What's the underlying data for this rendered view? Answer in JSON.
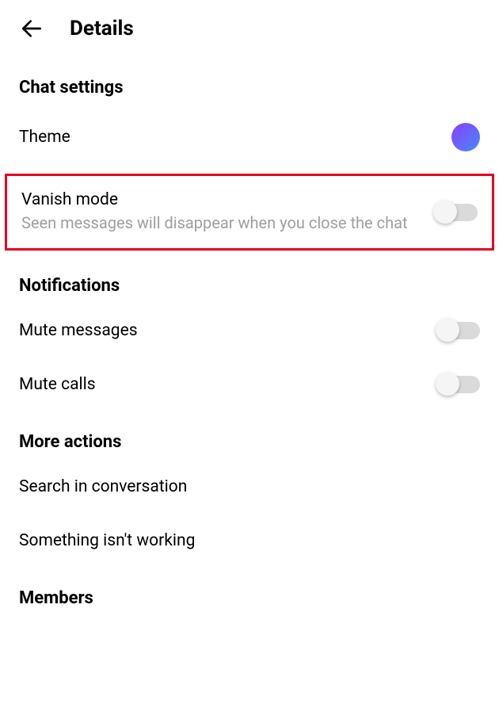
{
  "header": {
    "title": "Details"
  },
  "sections": {
    "chat_settings": {
      "title": "Chat settings",
      "theme": {
        "label": "Theme"
      },
      "vanish_mode": {
        "label": "Vanish mode",
        "description": "Seen messages will disappear when you close the chat",
        "enabled": false
      }
    },
    "notifications": {
      "title": "Notifications",
      "mute_messages": {
        "label": "Mute messages",
        "enabled": false
      },
      "mute_calls": {
        "label": "Mute calls",
        "enabled": false
      }
    },
    "more_actions": {
      "title": "More actions",
      "search": {
        "label": "Search in conversation"
      },
      "report": {
        "label": "Something isn't working"
      }
    },
    "members": {
      "title": "Members"
    }
  }
}
